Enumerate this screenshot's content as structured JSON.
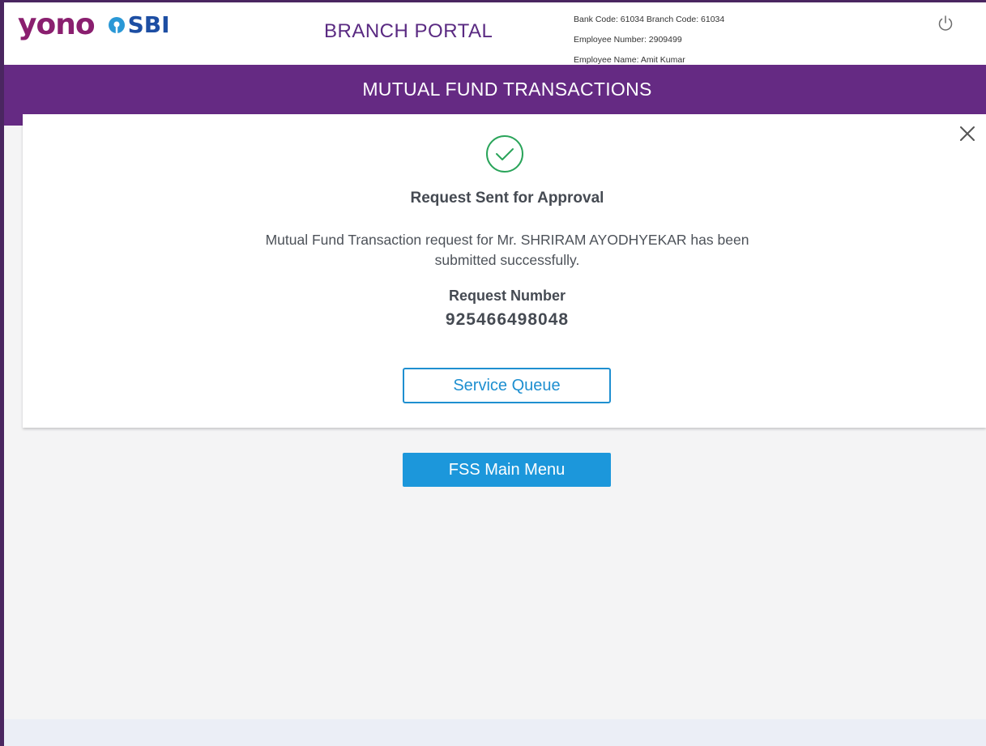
{
  "header": {
    "logo_yono": "yono",
    "logo_sbi": "SBI",
    "portal_title": "BRANCH PORTAL",
    "bank_code_line": "Bank Code: 61034 Branch Code: 61034",
    "employee_number_line": "Employee Number: 2909499",
    "employee_name_line": "Employee Name: Amit Kumar",
    "power_icon": "power-icon"
  },
  "banner": {
    "title": "MUTUAL FUND TRANSACTIONS"
  },
  "modal": {
    "status_icon": "check-circle-icon",
    "title": "Request Sent for Approval",
    "message_line1": "Mutual Fund Transaction request for Mr. SHRIRAM AYODHYEKAR has been",
    "message_line2": "submitted successfully.",
    "request_label": "Request Number",
    "request_number": "925466498048",
    "service_queue_label": "Service Queue",
    "close_icon": "close-icon"
  },
  "actions": {
    "main_menu_label": "FSS Main Menu"
  },
  "colors": {
    "brand_purple": "#652a83",
    "primary_blue": "#1c97db",
    "success_green": "#2aa45a"
  }
}
